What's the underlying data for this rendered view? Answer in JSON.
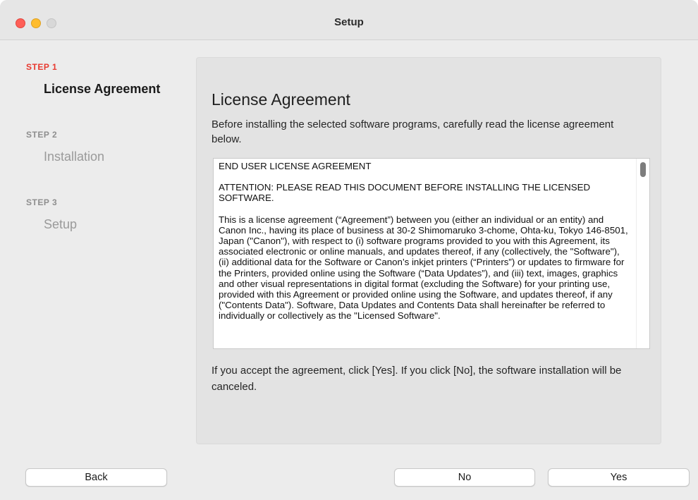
{
  "window": {
    "title": "Setup"
  },
  "steps": [
    {
      "label": "STEP 1",
      "name": "License Agreement",
      "active": true
    },
    {
      "label": "STEP 2",
      "name": "Installation",
      "active": false
    },
    {
      "label": "STEP 3",
      "name": "Setup",
      "active": false
    }
  ],
  "panel": {
    "title": "License Agreement",
    "intro": "Before installing the selected software programs, carefully read the license agreement below.",
    "license": {
      "heading": "END USER LICENSE AGREEMENT",
      "attention": "ATTENTION: PLEASE READ THIS DOCUMENT BEFORE INSTALLING THE LICENSED SOFTWARE.",
      "body": "This is a license agreement (“Agreement”) between you (either an individual or an entity) and Canon Inc., having its place of business at 30-2 Shimomaruko 3-chome, Ohta-ku, Tokyo 146-8501, Japan (\"Canon\"), with respect to (i) software programs provided to you with this Agreement, its associated electronic or online manuals, and updates thereof, if any (collectively, the \"Software\"), (ii) additional data for the Software or Canon’s inkjet printers (“Printers”) or updates to firmware for the Printers, provided online using the Software (“Data Updates”), and (iii) text, images, graphics and other visual representations in digital format (excluding the Software) for your printing use, provided with this Agreement or provided online using the Software, and updates thereof, if any (\"Contents Data\").  Software, Data Updates and Contents Data shall hereinafter be referred to individually or collectively as the \"Licensed Software\"."
    },
    "footer": "If you accept the agreement, click [Yes]. If you click [No], the software installation will be canceled."
  },
  "buttons": {
    "back": "Back",
    "no": "No",
    "yes": "Yes"
  },
  "colors": {
    "active_step": "#e8392f",
    "window_bg": "#ececec",
    "panel_bg": "#e3e3e3"
  }
}
